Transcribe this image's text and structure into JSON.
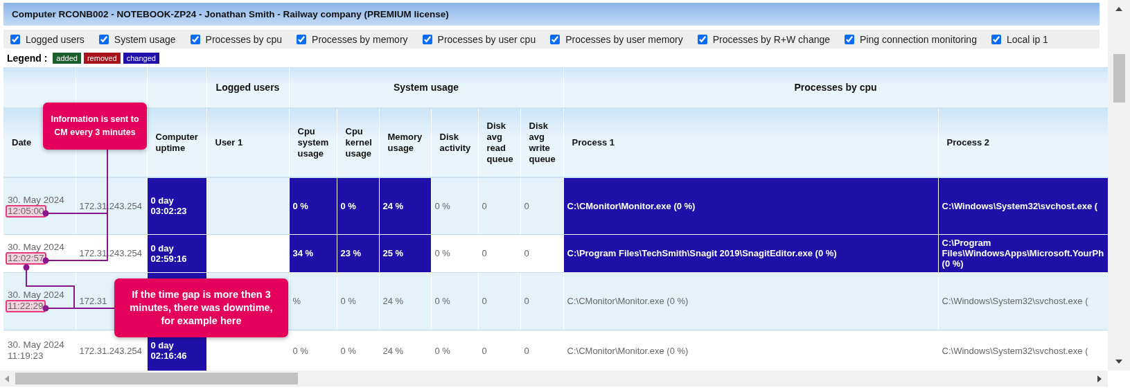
{
  "title": "Computer RCONB002 - NOTEBOOK-ZP24 - Jonathan Smith - Railway company (PREMIUM license)",
  "filters": [
    {
      "label": "Logged users",
      "checked": true
    },
    {
      "label": "System usage",
      "checked": true
    },
    {
      "label": "Processes by cpu",
      "checked": true
    },
    {
      "label": "Processes by memory",
      "checked": true
    },
    {
      "label": "Processes by user cpu",
      "checked": true
    },
    {
      "label": "Processes by user memory",
      "checked": true
    },
    {
      "label": "Processes by R+W change",
      "checked": true
    },
    {
      "label": "Ping connection monitoring",
      "checked": true
    },
    {
      "label": "Local ip 1",
      "checked": true
    }
  ],
  "legend": {
    "label": "Legend :",
    "items": [
      {
        "label": "added",
        "color": "#1b5e2b"
      },
      {
        "label": "removed",
        "color": "#a8141e"
      },
      {
        "label": "changed",
        "color": "#2010aa"
      }
    ]
  },
  "table": {
    "groups": [
      {
        "columns": [
          {
            "label": "Date"
          },
          {},
          {
            "label": "Computer uptime"
          }
        ]
      },
      {
        "label": "Logged users",
        "columns": [
          {
            "label": "User 1"
          }
        ]
      },
      {
        "label": "System usage",
        "columns": [
          {
            "label": "Cpu system usage"
          },
          {
            "label": "Cpu kernel usage"
          },
          {
            "label": "Memory usage"
          },
          {
            "label": "Disk activity"
          },
          {
            "label": "Disk avg read queue"
          },
          {
            "label": "Disk avg write queue"
          }
        ]
      },
      {
        "label": "Processes by cpu",
        "columns": [
          {
            "label": "Process 1"
          },
          {
            "label": "Process 2"
          }
        ]
      }
    ],
    "rows": [
      {
        "date": "30. May 2024",
        "time": "12:05:00",
        "time_marked": true,
        "cells": [
          {
            "text": "172.31.243.254",
            "changed": false
          },
          {
            "text": "0 day 03:02:23",
            "changed": true
          },
          {},
          {
            "text": "0 %",
            "changed": true
          },
          {
            "text": "0 %",
            "changed": true
          },
          {
            "text": "24 %",
            "changed": true
          },
          {
            "text": "0 %",
            "changed": false
          },
          {
            "text": "0",
            "changed": false
          },
          {
            "text": "0",
            "changed": false
          },
          {
            "text": "C:\\CMonitor\\Monitor.exe (0 %)",
            "changed": true
          },
          {
            "text": "C:\\Windows\\System32\\svchost.exe (",
            "changed": true
          }
        ]
      },
      {
        "date": "30. May 2024",
        "time": "12:02:57",
        "time_marked": true,
        "cells": [
          {
            "text": "172.31.243.254",
            "changed": false
          },
          {
            "text": "0 day 02:59:16",
            "changed": true
          },
          {},
          {
            "text": "34 %",
            "changed": true
          },
          {
            "text": "23 %",
            "changed": true
          },
          {
            "text": "25 %",
            "changed": true
          },
          {
            "text": "0 %",
            "changed": false
          },
          {
            "text": "0",
            "changed": false
          },
          {
            "text": "0",
            "changed": false
          },
          {
            "text": "C:\\Program Files\\TechSmith\\Snagit 2019\\SnagitEditor.exe (0 %)",
            "changed": true
          },
          {
            "text": "C:\\Program Files\\WindowsApps\\Microsoft.YourPh (0 %)",
            "changed": true
          }
        ]
      },
      {
        "date": "30. May 2024",
        "time": "11:22:29",
        "time_marked": true,
        "cells": [
          {
            "text": "172.31",
            "changed": false
          },
          {
            "changed": true
          },
          {},
          {
            "text": "%",
            "changed": false
          },
          {
            "text": "0 %",
            "changed": false
          },
          {
            "text": "24 %",
            "changed": false
          },
          {
            "text": "0 %",
            "changed": false
          },
          {
            "text": "0",
            "changed": false
          },
          {
            "text": "0",
            "changed": false
          },
          {
            "text": "C:\\CMonitor\\Monitor.exe (0 %)",
            "changed": false
          },
          {
            "text": "C:\\Windows\\System32\\svchost.exe (",
            "changed": false
          }
        ]
      },
      {
        "date": "30. May 2024",
        "time": "11:19:23",
        "time_marked": false,
        "cells": [
          {
            "text": "172.31.243.254",
            "changed": false
          },
          {
            "text": "0 day 02:16:46",
            "changed": true
          },
          {},
          {
            "text": "0 %",
            "changed": false
          },
          {
            "text": "0 %",
            "changed": false
          },
          {
            "text": "24 %",
            "changed": false
          },
          {
            "text": "0 %",
            "changed": false
          },
          {
            "text": "0",
            "changed": false
          },
          {
            "text": "0",
            "changed": false
          },
          {
            "text": "C:\\CMonitor\\Monitor.exe (0 %)",
            "changed": false
          },
          {
            "text": "C:\\Windows\\System32\\svchost.exe (",
            "changed": false
          }
        ]
      }
    ]
  },
  "callouts": [
    {
      "text": "Information is sent to CM every 3 minutes"
    },
    {
      "text": "If the time gap is more then 3 minutes, there was downtime, for example here"
    }
  ]
}
